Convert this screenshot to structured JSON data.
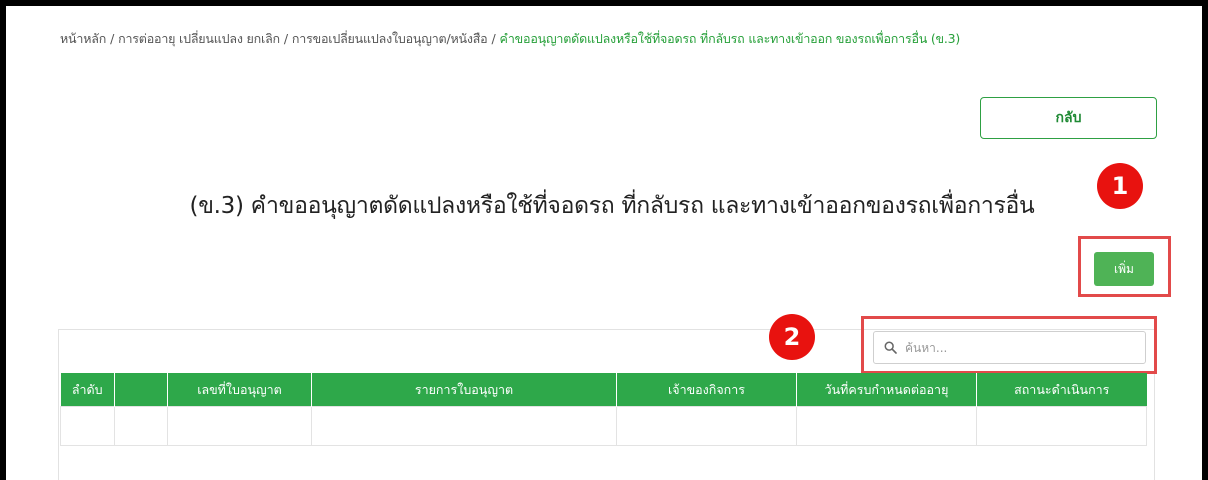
{
  "breadcrumb": [
    {
      "label": "หน้าหลัก",
      "current": false
    },
    {
      "label": "การต่ออายุ เปลี่ยนแปลง ยกเลิก",
      "current": false
    },
    {
      "label": "การขอเปลี่ยนแปลงใบอนุญาต/หนังสือ",
      "current": false
    },
    {
      "label": "คำขออนุญาตดัดแปลงหรือใช้ที่จอดรถ ที่กลับรถ และทางเข้าออก ของรถเพื่อการอื่น (ข.3)",
      "current": true
    }
  ],
  "breadcrumb_separator": "/",
  "back_label": "กลับ",
  "page_title": "(ข.3) คำขออนุญาตดัดแปลงหรือใช้ที่จอดรถ ที่กลับรถ และทางเข้าออกของรถเพื่อการอื่น",
  "add_label": "เพิ่ม",
  "search": {
    "placeholder": "ค้นหา..."
  },
  "markers": [
    "1",
    "2"
  ],
  "table": {
    "columns": [
      "ลำดับ",
      "",
      "เลขที่ใบอนุญาต",
      "รายการใบอนุญาต",
      "เจ้าของกิจการ",
      "วันที่ครบกำหนดต่ออายุ",
      "สถานะดำเนินการ"
    ],
    "rows": [
      [
        "",
        "",
        "",
        "",
        "",
        "",
        ""
      ]
    ]
  },
  "colors": {
    "accent": "#2ea84a",
    "button": "#4fb356",
    "marker": "#e8120f",
    "highlight": "#e24a4a",
    "breadcrumb_current": "#27a03a"
  }
}
